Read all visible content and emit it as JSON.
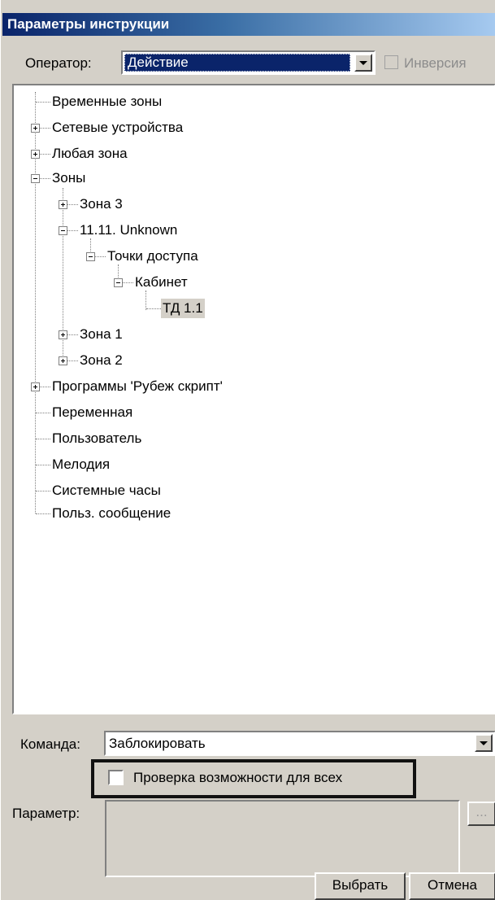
{
  "window": {
    "title": "Параметры инструкции"
  },
  "operator": {
    "label": "Оператор:",
    "value": "Действие",
    "inversion_label": "Инверсия",
    "inversion_checked": false
  },
  "tree": {
    "items": [
      {
        "label": "Временные зоны"
      },
      {
        "label": "Сетевые устройства"
      },
      {
        "label": "Любая зона"
      },
      {
        "label": "Зоны"
      },
      {
        "label": "Зона 3"
      },
      {
        "label": "11.11. Unknown"
      },
      {
        "label": "Точки доступа"
      },
      {
        "label": "Кабинет"
      },
      {
        "label": "ТД 1.1"
      },
      {
        "label": "Зона 1"
      },
      {
        "label": "Зона 2"
      },
      {
        "label": "Программы 'Рубеж скрипт'"
      },
      {
        "label": "Переменная"
      },
      {
        "label": "Пользователь"
      },
      {
        "label": "Мелодия"
      },
      {
        "label": "Системные часы"
      },
      {
        "label": "Польз. сообщение"
      }
    ]
  },
  "command": {
    "label": "Команда:",
    "value": "Заблокировать"
  },
  "check_all": {
    "label": "Проверка возможности для всех",
    "checked": false
  },
  "parameter": {
    "label": "Параметр:",
    "ellipsis": "..."
  },
  "buttons": {
    "select": "Выбрать",
    "cancel": "Отмена"
  }
}
